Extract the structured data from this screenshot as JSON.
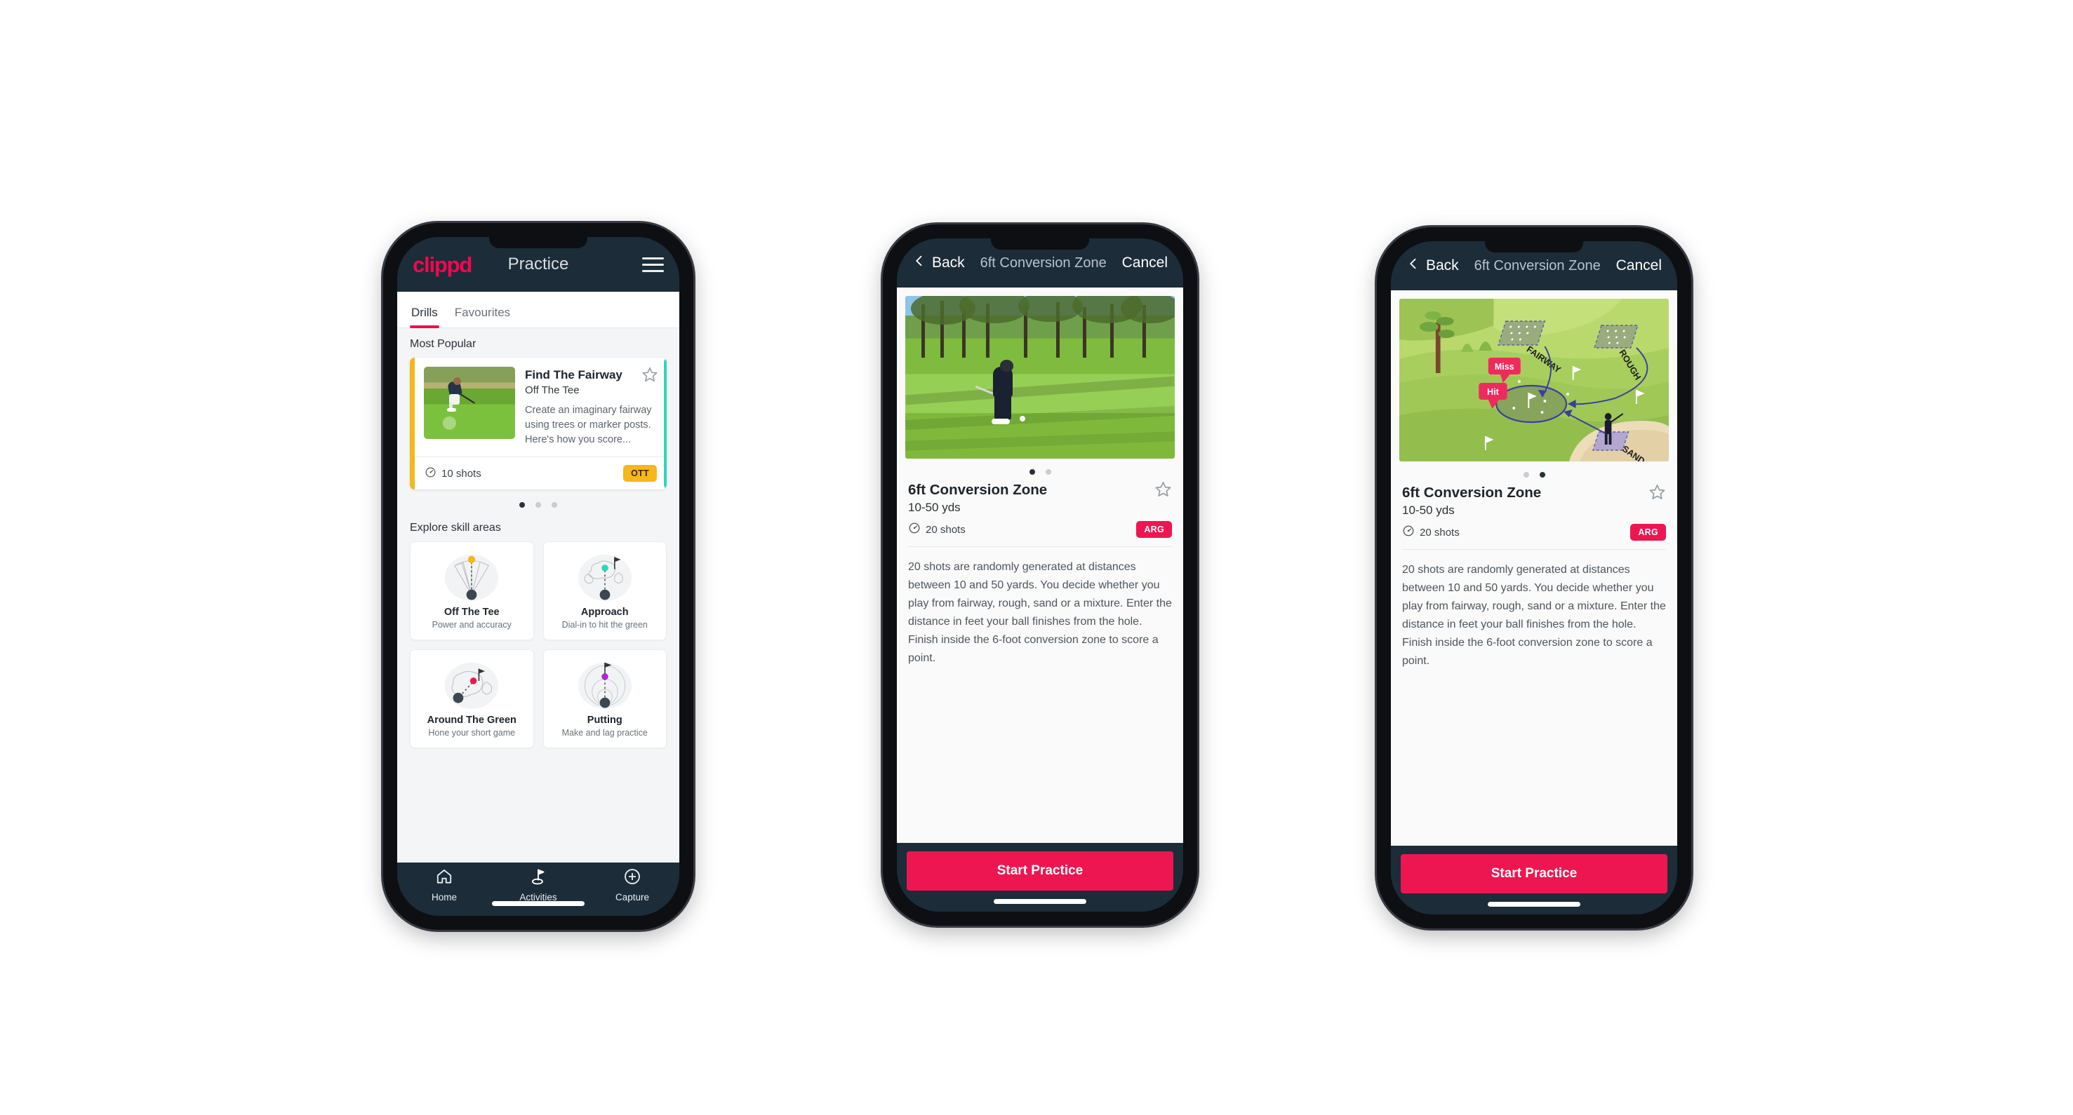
{
  "colors": {
    "brand_pink": "#f5054f",
    "accent_pink": "#ed1651",
    "header_navy": "#1c2c38",
    "chip_yellow": "#f5b719",
    "peek_teal": "#2fd5bb",
    "page_bg": "#f4f5f7"
  },
  "phone1": {
    "app_bar": {
      "brand": "clippd",
      "title": "Practice",
      "menu_icon": "hamburger-icon"
    },
    "tabs": [
      {
        "label": "Drills",
        "active": true
      },
      {
        "label": "Favourites",
        "active": false
      }
    ],
    "most_popular": {
      "section_label": "Most Popular",
      "card": {
        "title": "Find The Fairway",
        "subtitle": "Off The Tee",
        "description": "Create an imaginary fairway using trees or marker posts. Here's how you score...",
        "shots": "10 shots",
        "shots_icon": "target-icon",
        "chip": "OTT",
        "star_icon": "star-outline-icon",
        "thumbnail": "golfer-teeing-off-photo"
      },
      "dots": {
        "count": 3,
        "active_index": 0
      }
    },
    "skill_areas": {
      "section_label": "Explore skill areas",
      "items": [
        {
          "name": "Off The Tee",
          "desc": "Power and accuracy",
          "icon": "tee-shot-fan-icon",
          "dot_color": "#f5b719"
        },
        {
          "name": "Approach",
          "desc": "Dial-in to hit the green",
          "icon": "approach-green-icon",
          "dot_color": "#2fd5bb"
        },
        {
          "name": "Around The Green",
          "desc": "Hone your short game",
          "icon": "around-the-green-icon",
          "dot_color": "#ed1651"
        },
        {
          "name": "Putting",
          "desc": "Make and lag practice",
          "icon": "putting-rings-icon",
          "dot_color": "#b026d3"
        }
      ]
    },
    "bottom_nav": [
      {
        "label": "Home",
        "icon": "home-icon",
        "active": false
      },
      {
        "label": "Activities",
        "icon": "golf-flag-icon",
        "active": true
      },
      {
        "label": "Capture",
        "icon": "plus-circle-icon",
        "active": false
      }
    ]
  },
  "phone2": {
    "app_bar": {
      "back_label": "Back",
      "back_icon": "chevron-left-icon",
      "title": "6ft Conversion Zone",
      "cancel_label": "Cancel"
    },
    "hero": {
      "type": "photo",
      "alt": "golfer-pitching-on-fairway-photo"
    },
    "dots": {
      "count": 2,
      "active_index": 0
    },
    "detail": {
      "title": "6ft Conversion Zone",
      "range": "10-50 yds",
      "shots": "20 shots",
      "shots_icon": "target-icon",
      "chip": "ARG",
      "star_icon": "star-outline-icon",
      "description": "20 shots are randomly generated at distances between 10 and 50 yards. You decide whether you play from fairway, rough, sand or a mixture. Enter the distance in feet your ball finishes from the hole. Finish inside the 6-foot conversion zone to score a point."
    },
    "cta_label": "Start Practice"
  },
  "phone3": {
    "app_bar": {
      "back_label": "Back",
      "back_icon": "chevron-left-icon",
      "title": "6ft Conversion Zone",
      "cancel_label": "Cancel"
    },
    "hero": {
      "type": "illustration",
      "alt": "golf-course-diagram-illustration",
      "labels": [
        "FAIRWAY",
        "ROUGH",
        "SAND"
      ],
      "callouts": [
        "Miss",
        "Hit"
      ]
    },
    "dots": {
      "count": 2,
      "active_index": 1
    },
    "detail": {
      "title": "6ft Conversion Zone",
      "range": "10-50 yds",
      "shots": "20 shots",
      "shots_icon": "target-icon",
      "chip": "ARG",
      "star_icon": "star-outline-icon",
      "description": "20 shots are randomly generated at distances between 10 and 50 yards. You decide whether you play from fairway, rough, sand or a mixture. Enter the distance in feet your ball finishes from the hole. Finish inside the 6-foot conversion zone to score a point."
    },
    "cta_label": "Start Practice"
  }
}
